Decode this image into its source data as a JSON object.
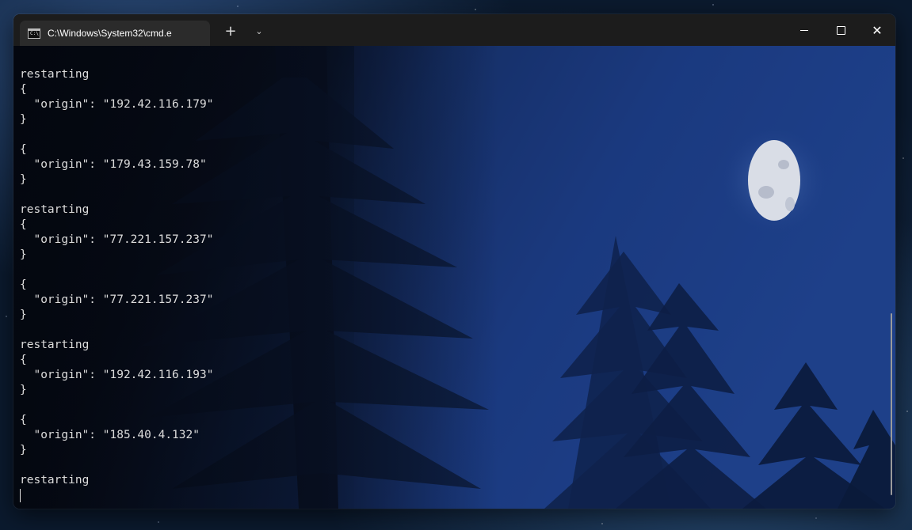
{
  "window": {
    "tab_title": "C:\\Windows\\System32\\cmd.e",
    "tab_icon": "C:\\",
    "new_tab_label": "+",
    "dropdown_label": "⌄",
    "close_tab_label": "✕",
    "close_label": "✕"
  },
  "terminal": {
    "lines": [
      "restarting",
      "{",
      "  \"origin\": \"192.42.116.179\"",
      "}",
      "",
      "{",
      "  \"origin\": \"179.43.159.78\"",
      "}",
      "",
      "restarting",
      "{",
      "  \"origin\": \"77.221.157.237\"",
      "}",
      "",
      "{",
      "  \"origin\": \"77.221.157.237\"",
      "}",
      "",
      "restarting",
      "{",
      "  \"origin\": \"192.42.116.193\"",
      "}",
      "",
      "{",
      "  \"origin\": \"185.40.4.132\"",
      "}",
      "",
      "restarting"
    ]
  },
  "colors": {
    "text": "#dcdcdc",
    "titlebar": "#1c1c1c",
    "tab_active": "#2b2b2b",
    "terminal_bg": "#060b18",
    "sky": "#1d3d85"
  }
}
